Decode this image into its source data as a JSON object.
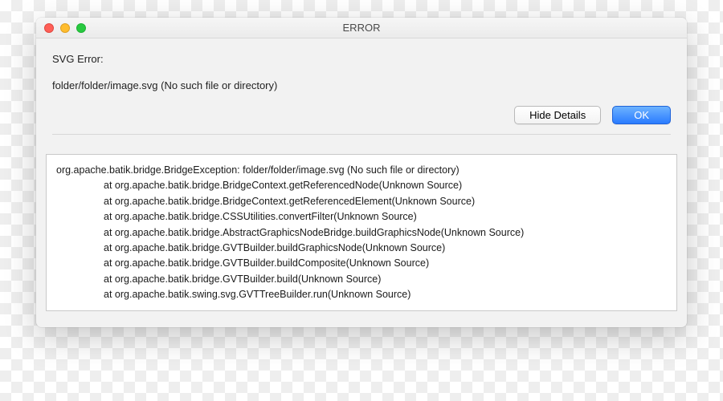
{
  "window": {
    "title": "ERROR"
  },
  "message": {
    "heading": "SVG Error:",
    "path_line": "folder/folder/image.svg (No such file or directory)"
  },
  "buttons": {
    "hide_details": "Hide Details",
    "ok": "OK"
  },
  "stack_trace": {
    "exception": "org.apache.batik.bridge.BridgeException: folder/folder/image.svg (No such file or directory)",
    "frames": [
      "at org.apache.batik.bridge.BridgeContext.getReferencedNode(Unknown Source)",
      "at org.apache.batik.bridge.BridgeContext.getReferencedElement(Unknown Source)",
      "at org.apache.batik.bridge.CSSUtilities.convertFilter(Unknown Source)",
      "at org.apache.batik.bridge.AbstractGraphicsNodeBridge.buildGraphicsNode(Unknown Source)",
      "at org.apache.batik.bridge.GVTBuilder.buildGraphicsNode(Unknown Source)",
      "at org.apache.batik.bridge.GVTBuilder.buildComposite(Unknown Source)",
      "at org.apache.batik.bridge.GVTBuilder.build(Unknown Source)",
      "at org.apache.batik.swing.svg.GVTTreeBuilder.run(Unknown Source)"
    ]
  }
}
